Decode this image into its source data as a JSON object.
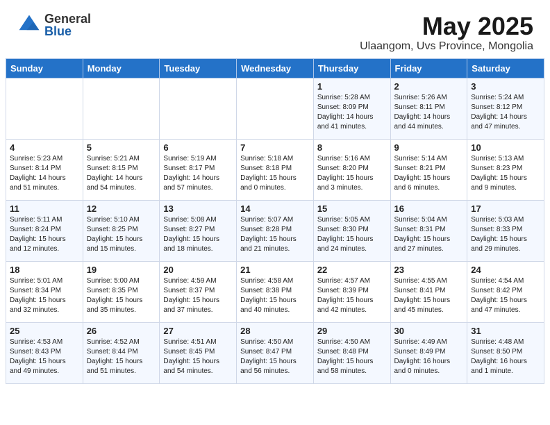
{
  "header": {
    "logo_general": "General",
    "logo_blue": "Blue",
    "month_title": "May 2025",
    "location": "Ulaangom, Uvs Province, Mongolia"
  },
  "weekdays": [
    "Sunday",
    "Monday",
    "Tuesday",
    "Wednesday",
    "Thursday",
    "Friday",
    "Saturday"
  ],
  "weeks": [
    [
      {
        "day": "",
        "info": ""
      },
      {
        "day": "",
        "info": ""
      },
      {
        "day": "",
        "info": ""
      },
      {
        "day": "",
        "info": ""
      },
      {
        "day": "1",
        "info": "Sunrise: 5:28 AM\nSunset: 8:09 PM\nDaylight: 14 hours\nand 41 minutes."
      },
      {
        "day": "2",
        "info": "Sunrise: 5:26 AM\nSunset: 8:11 PM\nDaylight: 14 hours\nand 44 minutes."
      },
      {
        "day": "3",
        "info": "Sunrise: 5:24 AM\nSunset: 8:12 PM\nDaylight: 14 hours\nand 47 minutes."
      }
    ],
    [
      {
        "day": "4",
        "info": "Sunrise: 5:23 AM\nSunset: 8:14 PM\nDaylight: 14 hours\nand 51 minutes."
      },
      {
        "day": "5",
        "info": "Sunrise: 5:21 AM\nSunset: 8:15 PM\nDaylight: 14 hours\nand 54 minutes."
      },
      {
        "day": "6",
        "info": "Sunrise: 5:19 AM\nSunset: 8:17 PM\nDaylight: 14 hours\nand 57 minutes."
      },
      {
        "day": "7",
        "info": "Sunrise: 5:18 AM\nSunset: 8:18 PM\nDaylight: 15 hours\nand 0 minutes."
      },
      {
        "day": "8",
        "info": "Sunrise: 5:16 AM\nSunset: 8:20 PM\nDaylight: 15 hours\nand 3 minutes."
      },
      {
        "day": "9",
        "info": "Sunrise: 5:14 AM\nSunset: 8:21 PM\nDaylight: 15 hours\nand 6 minutes."
      },
      {
        "day": "10",
        "info": "Sunrise: 5:13 AM\nSunset: 8:23 PM\nDaylight: 15 hours\nand 9 minutes."
      }
    ],
    [
      {
        "day": "11",
        "info": "Sunrise: 5:11 AM\nSunset: 8:24 PM\nDaylight: 15 hours\nand 12 minutes."
      },
      {
        "day": "12",
        "info": "Sunrise: 5:10 AM\nSunset: 8:25 PM\nDaylight: 15 hours\nand 15 minutes."
      },
      {
        "day": "13",
        "info": "Sunrise: 5:08 AM\nSunset: 8:27 PM\nDaylight: 15 hours\nand 18 minutes."
      },
      {
        "day": "14",
        "info": "Sunrise: 5:07 AM\nSunset: 8:28 PM\nDaylight: 15 hours\nand 21 minutes."
      },
      {
        "day": "15",
        "info": "Sunrise: 5:05 AM\nSunset: 8:30 PM\nDaylight: 15 hours\nand 24 minutes."
      },
      {
        "day": "16",
        "info": "Sunrise: 5:04 AM\nSunset: 8:31 PM\nDaylight: 15 hours\nand 27 minutes."
      },
      {
        "day": "17",
        "info": "Sunrise: 5:03 AM\nSunset: 8:33 PM\nDaylight: 15 hours\nand 29 minutes."
      }
    ],
    [
      {
        "day": "18",
        "info": "Sunrise: 5:01 AM\nSunset: 8:34 PM\nDaylight: 15 hours\nand 32 minutes."
      },
      {
        "day": "19",
        "info": "Sunrise: 5:00 AM\nSunset: 8:35 PM\nDaylight: 15 hours\nand 35 minutes."
      },
      {
        "day": "20",
        "info": "Sunrise: 4:59 AM\nSunset: 8:37 PM\nDaylight: 15 hours\nand 37 minutes."
      },
      {
        "day": "21",
        "info": "Sunrise: 4:58 AM\nSunset: 8:38 PM\nDaylight: 15 hours\nand 40 minutes."
      },
      {
        "day": "22",
        "info": "Sunrise: 4:57 AM\nSunset: 8:39 PM\nDaylight: 15 hours\nand 42 minutes."
      },
      {
        "day": "23",
        "info": "Sunrise: 4:55 AM\nSunset: 8:41 PM\nDaylight: 15 hours\nand 45 minutes."
      },
      {
        "day": "24",
        "info": "Sunrise: 4:54 AM\nSunset: 8:42 PM\nDaylight: 15 hours\nand 47 minutes."
      }
    ],
    [
      {
        "day": "25",
        "info": "Sunrise: 4:53 AM\nSunset: 8:43 PM\nDaylight: 15 hours\nand 49 minutes."
      },
      {
        "day": "26",
        "info": "Sunrise: 4:52 AM\nSunset: 8:44 PM\nDaylight: 15 hours\nand 51 minutes."
      },
      {
        "day": "27",
        "info": "Sunrise: 4:51 AM\nSunset: 8:45 PM\nDaylight: 15 hours\nand 54 minutes."
      },
      {
        "day": "28",
        "info": "Sunrise: 4:50 AM\nSunset: 8:47 PM\nDaylight: 15 hours\nand 56 minutes."
      },
      {
        "day": "29",
        "info": "Sunrise: 4:50 AM\nSunset: 8:48 PM\nDaylight: 15 hours\nand 58 minutes."
      },
      {
        "day": "30",
        "info": "Sunrise: 4:49 AM\nSunset: 8:49 PM\nDaylight: 16 hours\nand 0 minutes."
      },
      {
        "day": "31",
        "info": "Sunrise: 4:48 AM\nSunset: 8:50 PM\nDaylight: 16 hours\nand 1 minute."
      }
    ]
  ]
}
